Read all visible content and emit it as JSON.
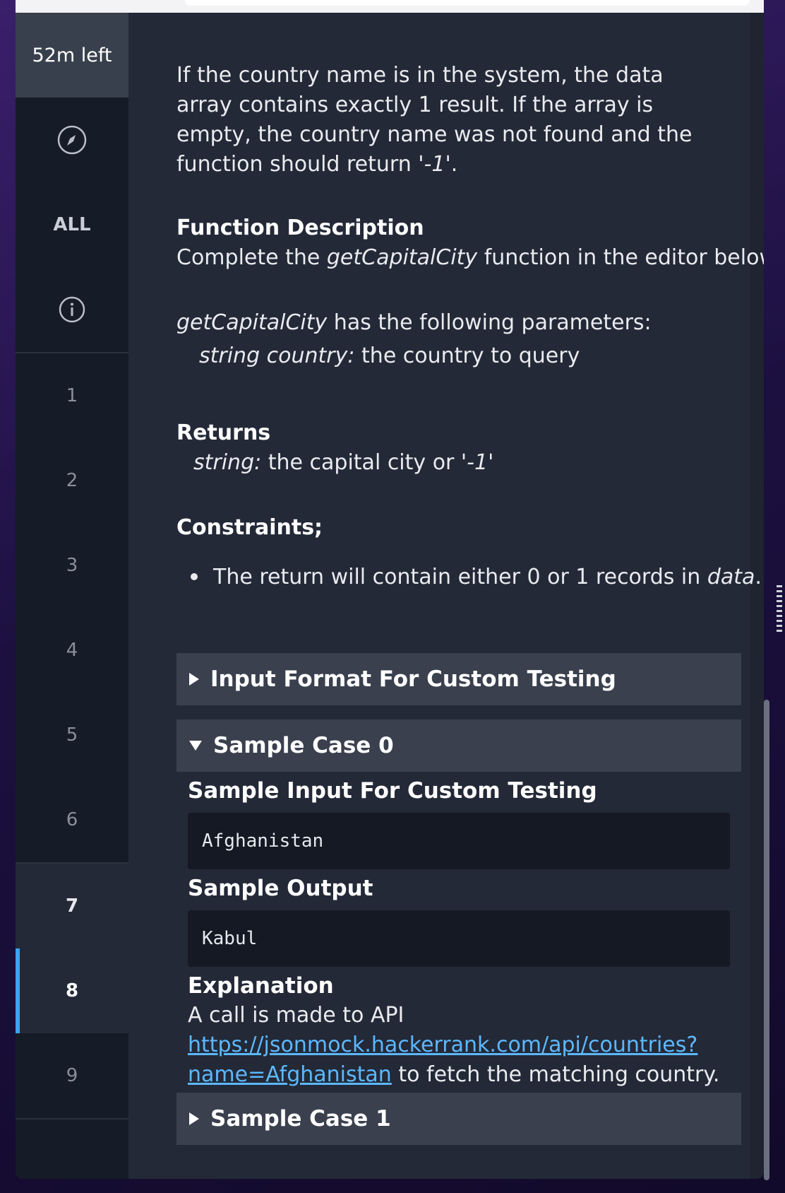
{
  "sidebar": {
    "timer": "52m left",
    "all_label": "ALL",
    "icons": [
      "compass-icon",
      "info-icon"
    ],
    "questions": [
      "1",
      "2",
      "3",
      "4",
      "5",
      "6",
      "7",
      "8",
      "9"
    ],
    "active_question": "8",
    "accent_color": "#39a4ff"
  },
  "content": {
    "intro": {
      "p1": "If the country name is in the system, the data array contains exactly 1 result. If the array is empty, the country name was not found and the function should return '",
      "p1_em": "-1",
      "p1_end": "'."
    },
    "function_description": {
      "heading": "Function Description",
      "line_pre": "Complete the ",
      "line_em": "getCapitalCity",
      "line_post": " function in the editor below."
    },
    "parameters": {
      "fn_em": "getCapitalCity",
      "fn_post": " has the following parameters:",
      "param_em": "string country:",
      "param_post": " the country to query"
    },
    "returns": {
      "heading": "Returns",
      "type_em": "string:",
      "desc_pre": " the capital city or '",
      "desc_em": "-1",
      "desc_post": "'"
    },
    "constraints": {
      "heading": "Constraints;",
      "item_pre": "The return will contain either 0 or 1 records in ",
      "item_em": "data",
      "item_post": "."
    },
    "sections": {
      "input_format": "Input Format For Custom Testing",
      "sample0": "Sample Case 0",
      "sample1": "Sample Case 1"
    },
    "sample0": {
      "input_heading": "Sample Input For Custom Testing",
      "input_value": "Afghanistan",
      "output_heading": "Sample Output",
      "output_value": "Kabul",
      "explanation_heading": "Explanation",
      "explanation_pre": "A call is made to API",
      "link_line1": "https://jsonmock.hackerrank.com/api/countries?",
      "link_line2": "name=Afghanistan",
      "explanation_post": " to fetch the matching country."
    }
  }
}
